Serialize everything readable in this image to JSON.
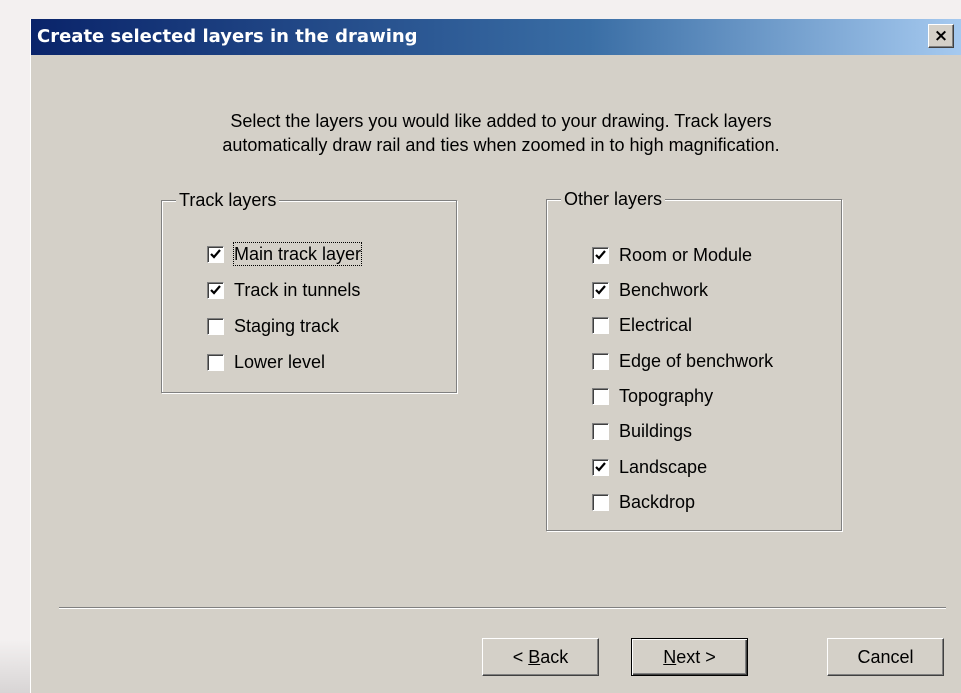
{
  "window": {
    "title": "Create selected layers in the drawing",
    "close_label": "×"
  },
  "instructions": {
    "line1": "Select the layers you would like added to your drawing. Track layers",
    "line2": "automatically draw rail and ties when zoomed in to high magnification."
  },
  "track_layers": {
    "legend": "Track layers",
    "items": [
      {
        "label": "Main track layer",
        "checked": true
      },
      {
        "label": "Track in tunnels",
        "checked": true
      },
      {
        "label": "Staging track",
        "checked": false
      },
      {
        "label": "Lower level",
        "checked": false
      }
    ]
  },
  "other_layers": {
    "legend": "Other layers",
    "items": [
      {
        "label": "Room or Module",
        "checked": true
      },
      {
        "label": "Benchwork",
        "checked": true
      },
      {
        "label": "Electrical",
        "checked": false
      },
      {
        "label": "Edge of benchwork",
        "checked": false
      },
      {
        "label": "Topography",
        "checked": false
      },
      {
        "label": "Buildings",
        "checked": false
      },
      {
        "label": "Landscape",
        "checked": true
      },
      {
        "label": "Backdrop",
        "checked": false
      }
    ]
  },
  "buttons": {
    "back_label": "< Back",
    "next_label": "Next >",
    "cancel_label": "Cancel"
  },
  "colors": {
    "title_bar_start": "#0a246a",
    "title_bar_end": "#a6caf0",
    "dialog_face": "#d4d0c8"
  }
}
